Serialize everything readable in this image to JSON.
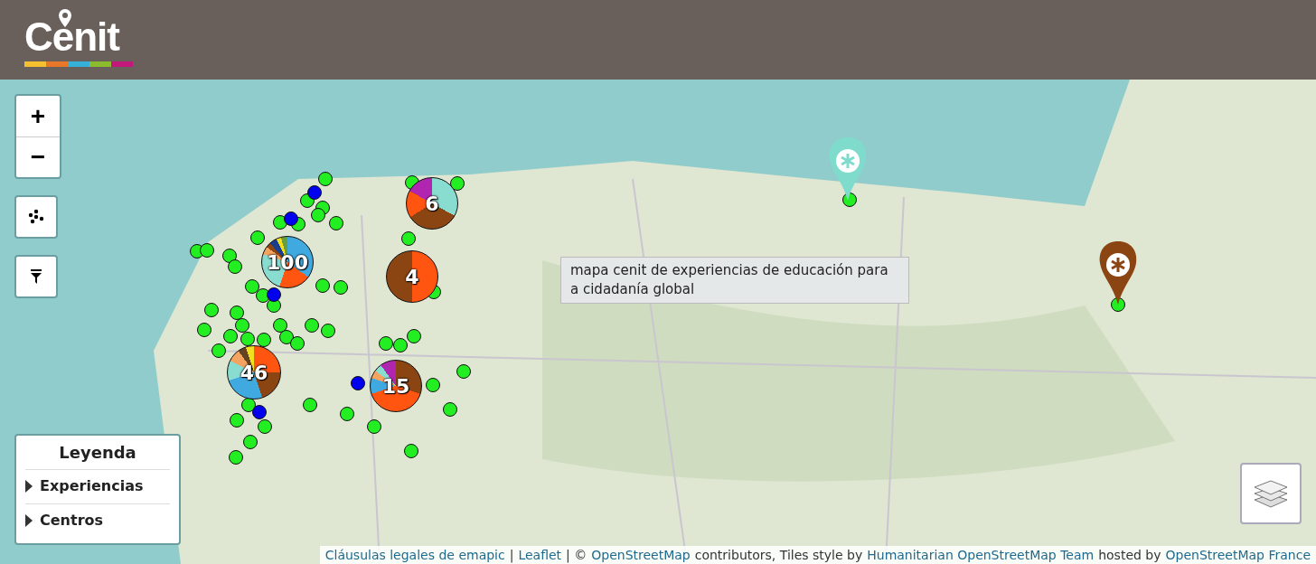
{
  "header": {
    "logo_text": "Cenit"
  },
  "zoom_controls": {
    "zoom_in": "+",
    "zoom_out": "−"
  },
  "clusters": [
    {
      "count": "100"
    },
    {
      "count": "6"
    },
    {
      "count": "4"
    },
    {
      "count": "46"
    },
    {
      "count": "15"
    }
  ],
  "points": [
    {
      "color": "#22ee22"
    },
    {
      "color": "#22ee22"
    },
    {
      "color": "#22ee22"
    },
    {
      "color": "#22ee22"
    },
    {
      "color": "#22ee22"
    },
    {
      "color": "#22ee22"
    },
    {
      "color": "#22ee22"
    },
    {
      "color": "#22ee22"
    },
    {
      "color": "#22ee22"
    },
    {
      "color": "#22ee22"
    },
    {
      "color": "#22ee22"
    },
    {
      "color": "#22ee22"
    },
    {
      "color": "#22ee22"
    },
    {
      "color": "#22ee22"
    },
    {
      "color": "#22ee22"
    },
    {
      "color": "#22ee22"
    },
    {
      "color": "#22ee22"
    },
    {
      "color": "#22ee22"
    },
    {
      "color": "#22ee22"
    },
    {
      "color": "#22ee22"
    },
    {
      "color": "#22ee22"
    },
    {
      "color": "#22ee22"
    },
    {
      "color": "#22ee22"
    },
    {
      "color": "#22ee22"
    },
    {
      "color": "#22ee22"
    },
    {
      "color": "#22ee22"
    },
    {
      "color": "#22ee22"
    },
    {
      "color": "#22ee22"
    },
    {
      "color": "#22ee22"
    },
    {
      "color": "#22ee22"
    },
    {
      "color": "#22ee22"
    },
    {
      "color": "#22ee22"
    },
    {
      "color": "#22ee22"
    },
    {
      "color": "#22ee22"
    },
    {
      "color": "#22ee22"
    },
    {
      "color": "#22ee22"
    },
    {
      "color": "#22ee22"
    },
    {
      "color": "#22ee22"
    },
    {
      "color": "#22ee22"
    },
    {
      "color": "#22ee22"
    },
    {
      "color": "#22ee22"
    },
    {
      "color": "#22ee22"
    },
    {
      "color": "#22ee22"
    },
    {
      "color": "#22ee22"
    },
    {
      "color": "#22ee22"
    },
    {
      "color": "#22ee22"
    },
    {
      "color": "#22ee22"
    },
    {
      "color": "#22ee22"
    },
    {
      "color": "#22ee22"
    },
    {
      "color": "#22ee22"
    },
    {
      "color": "#22ee22"
    },
    {
      "color": "#0000ee"
    },
    {
      "color": "#0000ee"
    },
    {
      "color": "#0000ee"
    },
    {
      "color": "#0000ee"
    },
    {
      "color": "#0000ee"
    }
  ],
  "pins": [
    {
      "color": "#7fdccd"
    },
    {
      "color": "#8b4513"
    }
  ],
  "tooltip": "mapa cenit de experiencias de educación para a cidadanía global",
  "legend": {
    "title": "Leyenda",
    "items": [
      {
        "label": "Experiencias",
        "expanded": false
      },
      {
        "label": "Centros",
        "expanded": false
      }
    ]
  },
  "attribution": [
    {
      "kind": "link",
      "text": "Cláusulas legales de emapic"
    },
    {
      "kind": "text",
      "text": "|"
    },
    {
      "kind": "link",
      "text": "Leaflet"
    },
    {
      "kind": "text",
      "text": "| © "
    },
    {
      "kind": "link",
      "text": "OpenStreetMap"
    },
    {
      "kind": "text",
      "text": "contributors, Tiles style by"
    },
    {
      "kind": "link",
      "text": "Humanitarian OpenStreetMap Team"
    },
    {
      "kind": "text",
      "text": "hosted by"
    },
    {
      "kind": "link",
      "text": "OpenStreetMap France"
    }
  ]
}
